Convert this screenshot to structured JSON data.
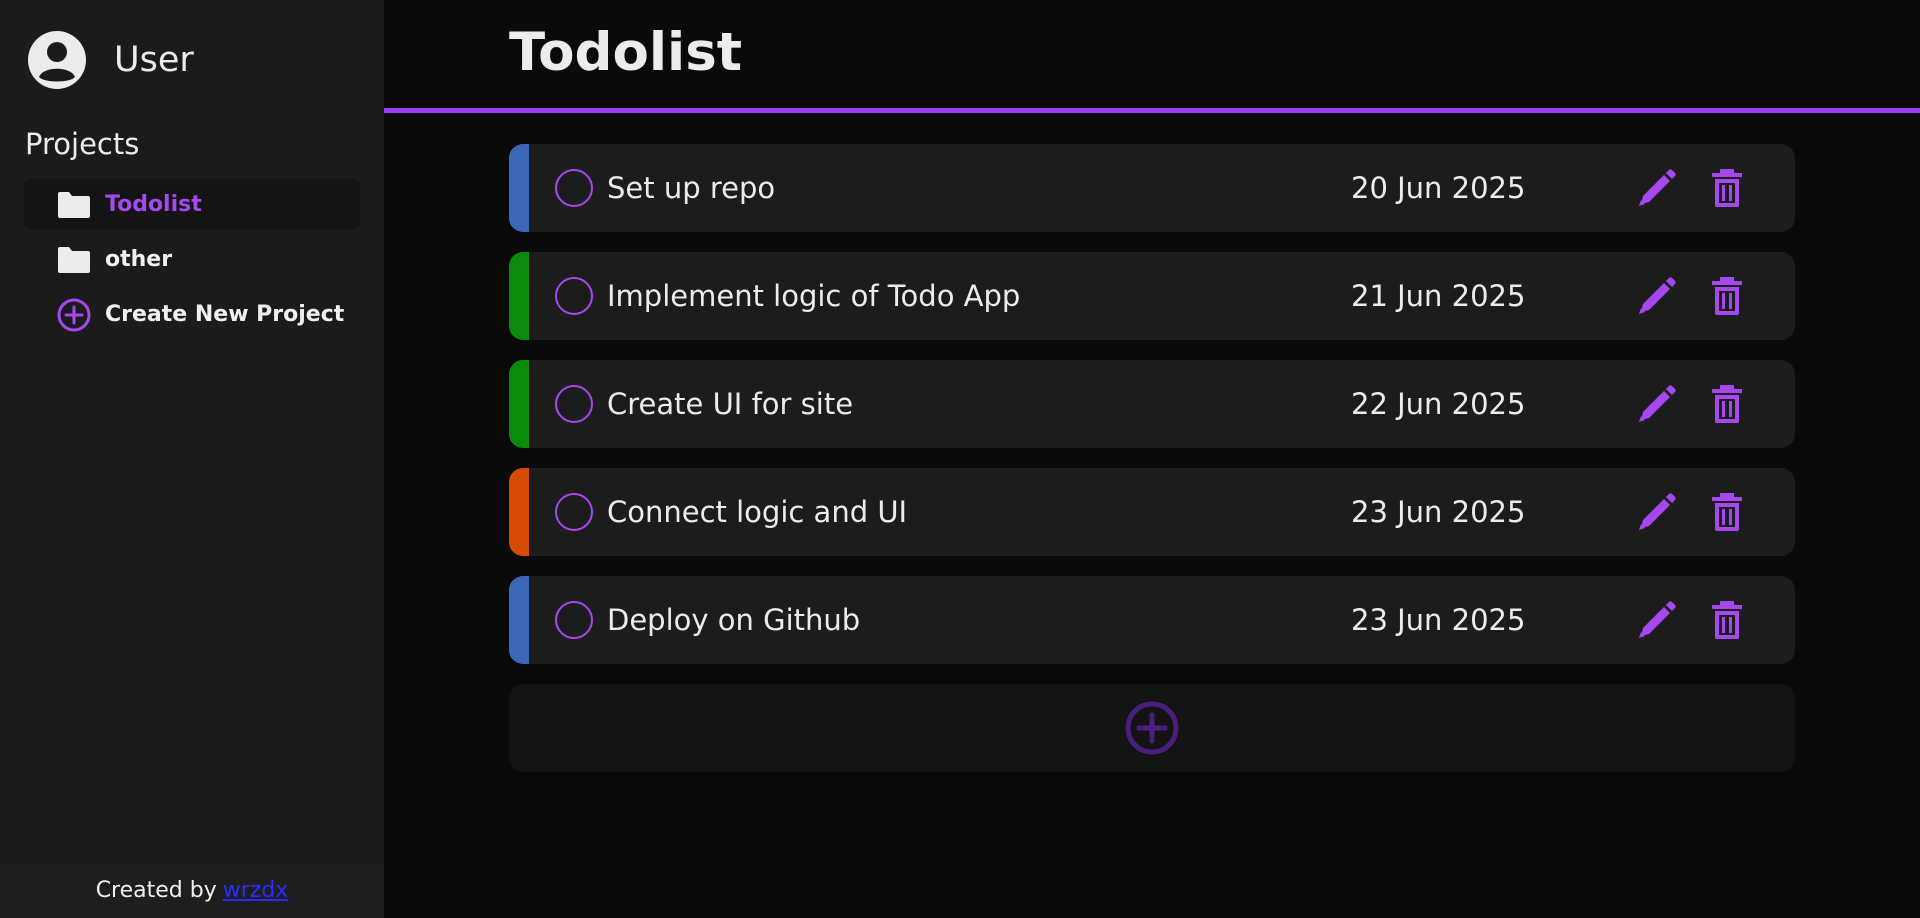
{
  "sidebar": {
    "user_name": "User",
    "projects_heading": "Projects",
    "projects": [
      {
        "label": "Todolist",
        "active": true,
        "icon": "folder-icon"
      },
      {
        "label": "other",
        "active": false,
        "icon": "folder-icon"
      }
    ],
    "create_project_label": "Create New Project",
    "footer_text": "Created by",
    "footer_link": "wrzdx"
  },
  "main": {
    "title": "Todolist",
    "todos": [
      {
        "title": "Set up repo",
        "date": "20 Jun 2025",
        "priority_color": "#3e66b7"
      },
      {
        "title": "Implement logic of Todo App",
        "date": "21 Jun 2025",
        "priority_color": "#0b8a0b"
      },
      {
        "title": "Create UI for site",
        "date": "22 Jun 2025",
        "priority_color": "#0b8a0b"
      },
      {
        "title": "Connect logic and UI",
        "date": "23 Jun 2025",
        "priority_color": "#d64b06"
      },
      {
        "title": "Deploy on Github",
        "date": "23 Jun 2025",
        "priority_color": "#3e66b7"
      }
    ]
  },
  "colors": {
    "accent": "#a548f0",
    "sidebar_bg": "#1b1b1b",
    "main_bg": "#0a0a0a",
    "card_bg": "#1c1c1c",
    "add_icon": "#4a1f80"
  }
}
